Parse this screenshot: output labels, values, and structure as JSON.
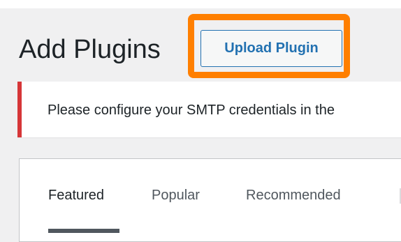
{
  "page": {
    "title": "Add Plugins",
    "upload_button_label": "Upload Plugin"
  },
  "notice": {
    "text": "Please configure your SMTP credentials in the",
    "accent_color": "#d63638"
  },
  "tabs": [
    {
      "label": "Featured",
      "current": true
    },
    {
      "label": "Popular",
      "current": false
    },
    {
      "label": "Recommended",
      "current": false
    }
  ],
  "colors": {
    "highlight": "#ff7f00",
    "link": "#2271b1",
    "background": "#f0f0f1"
  }
}
